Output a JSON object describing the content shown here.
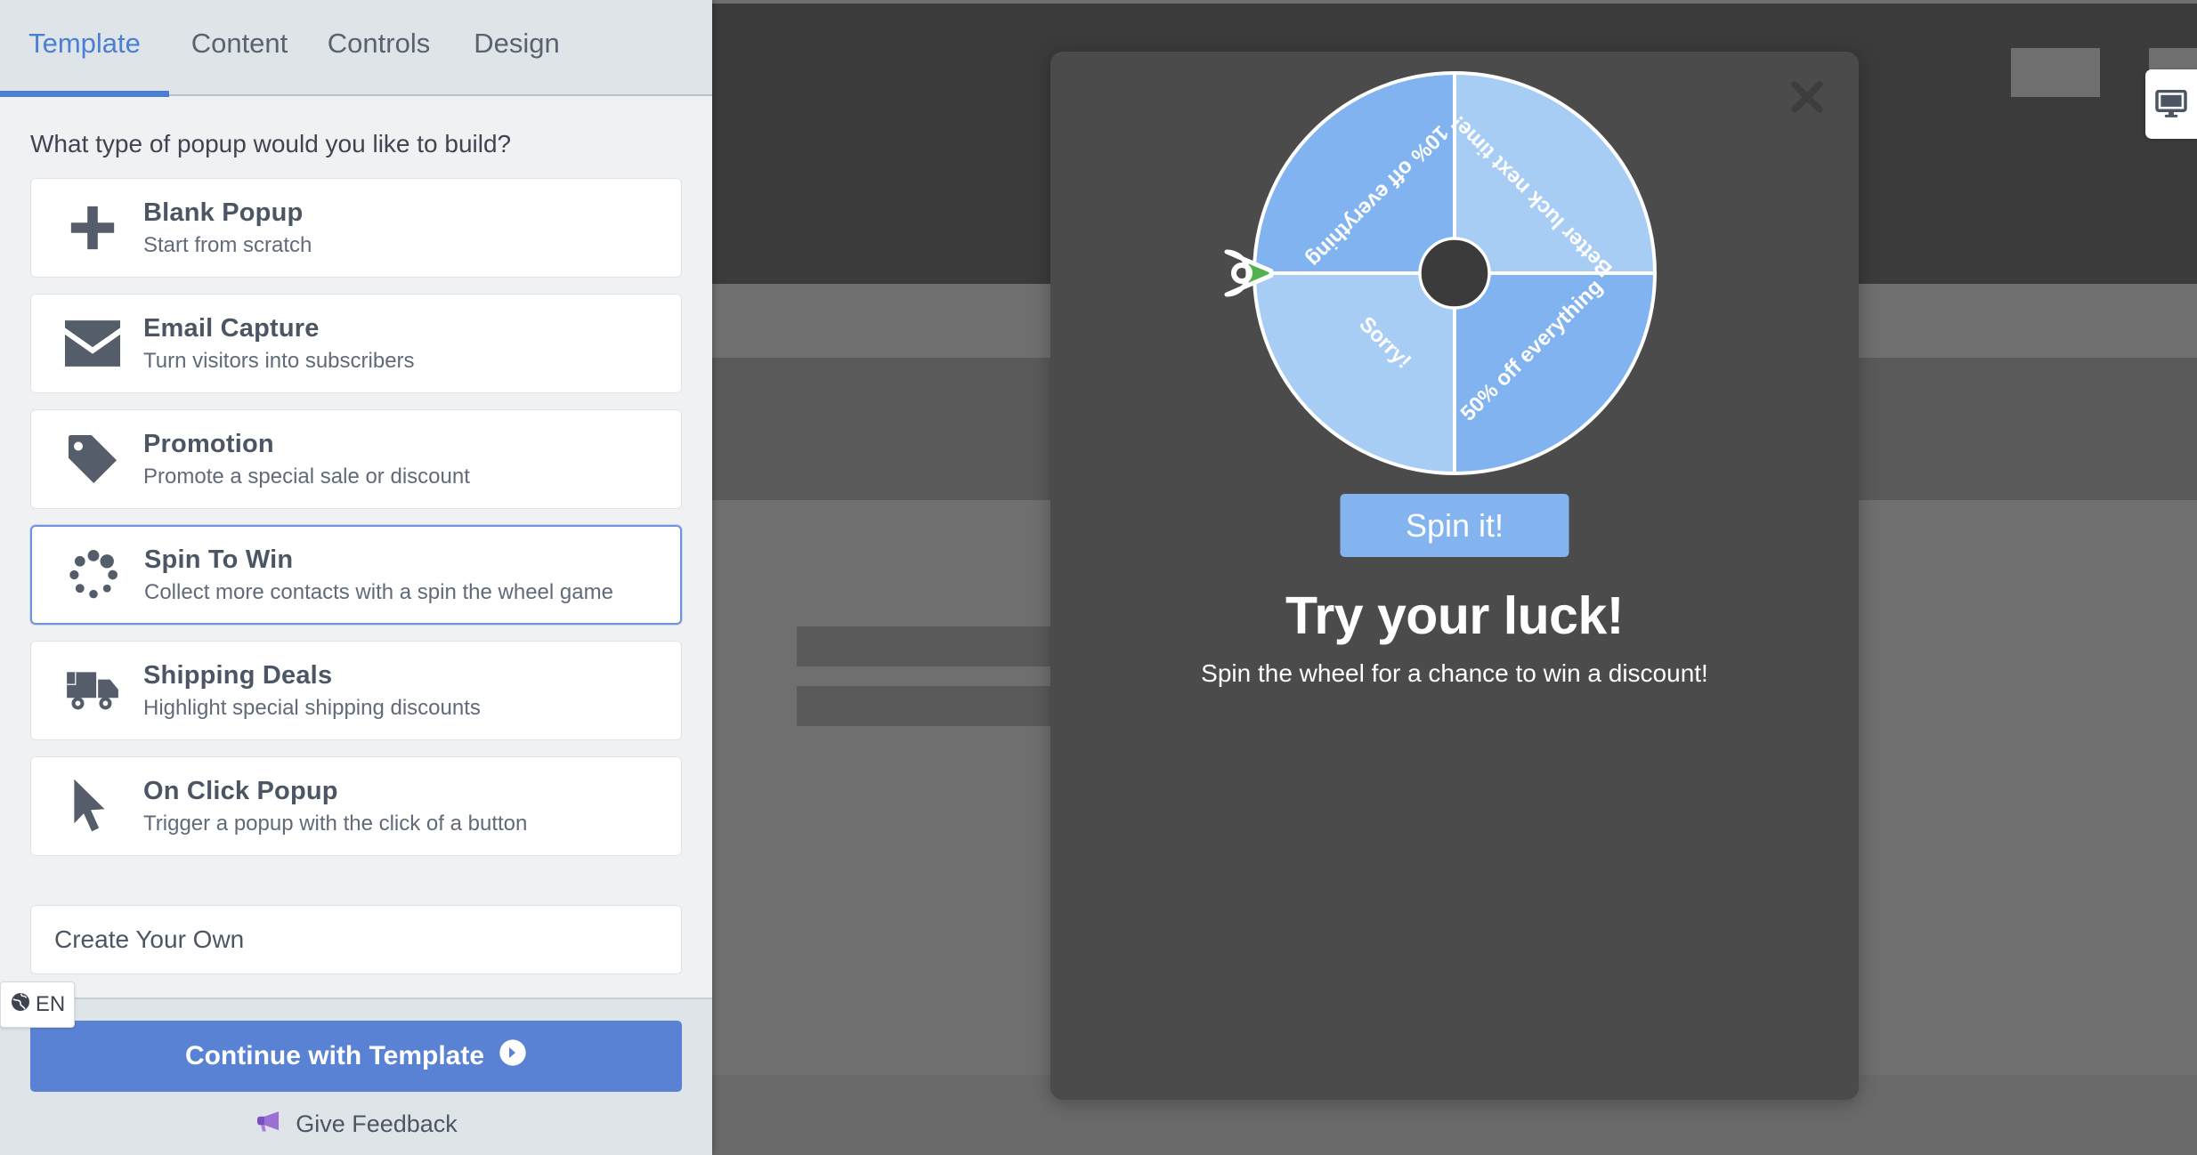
{
  "editor": {
    "tabs": [
      {
        "label": "Template",
        "active": true
      },
      {
        "label": "Content",
        "active": false
      },
      {
        "label": "Controls",
        "active": false
      },
      {
        "label": "Design",
        "active": false
      }
    ],
    "heading": "What type of popup would you like to build?",
    "templates": [
      {
        "title": "Blank Popup",
        "subtitle": "Start from scratch",
        "icon": "plus-icon",
        "selected": false
      },
      {
        "title": "Email Capture",
        "subtitle": "Turn visitors into subscribers",
        "icon": "envelope-icon",
        "selected": false
      },
      {
        "title": "Promotion",
        "subtitle": "Promote a special sale or discount",
        "icon": "tag-icon",
        "selected": false
      },
      {
        "title": "Spin To Win",
        "subtitle": "Collect more contacts with a spin the wheel game",
        "icon": "spinner-icon",
        "selected": true
      },
      {
        "title": "Shipping Deals",
        "subtitle": "Highlight special shipping discounts",
        "icon": "truck-icon",
        "selected": false
      },
      {
        "title": "On Click Popup",
        "subtitle": "Trigger a popup with the click of a button",
        "icon": "cursor-icon",
        "selected": false
      }
    ],
    "create_own_placeholder": "Create Your Own",
    "continue_label": "Continue with Template",
    "continue_icon": "arrow-circle-right-icon",
    "feedback_label": "Give Feedback",
    "feedback_icon": "megaphone-icon",
    "language_badge": {
      "code": "EN",
      "icon": "globe-icon"
    },
    "accent_color": "#5a82d4",
    "selected_border_color": "#6e93dd"
  },
  "preview": {
    "device_icon": "desktop-monitor-icon",
    "popup": {
      "close_icon": "close-x-icon",
      "spin_button_label": "Spin it!",
      "title": "Try your luck!",
      "subtitle": "Spin the wheel for a chance to win a discount!",
      "spin_button_color": "#83b4f0",
      "background_color": "#4b4b4b",
      "pointer_color": "#52b14f",
      "hub_color": "#3b3b3b",
      "wheel": {
        "segment_colors": [
          "#80b3f0",
          "#a8cdf5",
          "#a8cdf5",
          "#80b3f0"
        ],
        "segments": [
          {
            "label": "Sorry!",
            "color": "#80b3f0"
          },
          {
            "label": "50% off everything",
            "color": "#a8cdf5"
          },
          {
            "label": "Better luck next time!",
            "color": "#80b3f0"
          },
          {
            "label": "10% off everything",
            "color": "#a8cdf5"
          }
        ]
      }
    }
  }
}
